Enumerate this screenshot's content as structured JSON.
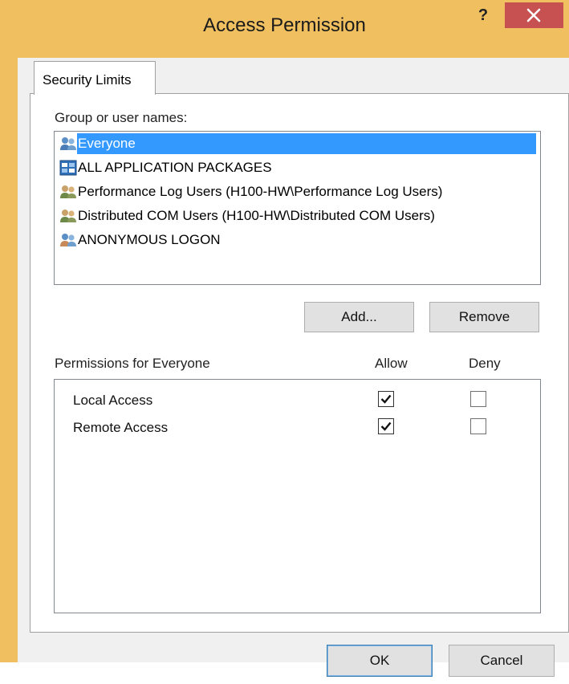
{
  "window": {
    "title": "Access Permission",
    "help_label": "?"
  },
  "tab": {
    "label": "Security Limits"
  },
  "groups": {
    "label": "Group or user names:",
    "items": [
      {
        "name": "Everyone",
        "icon": "users-icon",
        "selected": true
      },
      {
        "name": "ALL APPLICATION PACKAGES",
        "icon": "application-packages-icon",
        "selected": false
      },
      {
        "name": "Performance Log Users (H100-HW\\Performance Log Users)",
        "icon": "users-icon",
        "selected": false
      },
      {
        "name": "Distributed COM Users (H100-HW\\Distributed COM Users)",
        "icon": "users-icon",
        "selected": false
      },
      {
        "name": "ANONYMOUS LOGON",
        "icon": "users-icon",
        "selected": false
      }
    ]
  },
  "buttons": {
    "add": "Add...",
    "remove": "Remove",
    "ok": "OK",
    "cancel": "Cancel"
  },
  "permissions": {
    "label": "Permissions for Everyone",
    "allow_header": "Allow",
    "deny_header": "Deny",
    "items": [
      {
        "name": "Local Access",
        "allow": true,
        "deny": false
      },
      {
        "name": "Remote Access",
        "allow": true,
        "deny": false
      }
    ]
  },
  "colors": {
    "titlebar": "#f0c060",
    "close": "#c75050",
    "selection": "#3399ff"
  }
}
